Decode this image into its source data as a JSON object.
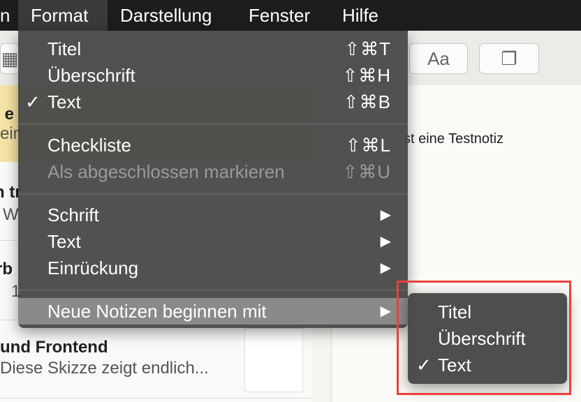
{
  "menubar": {
    "partial_item": "n",
    "items": [
      "Format",
      "Darstellung",
      "Fenster",
      "Hilfe"
    ]
  },
  "toolbar": {
    "font_button": "Aa"
  },
  "notes_list": {
    "note1": {
      "title_partial": "t e",
      "preview_partial": "ein"
    },
    "note2": {
      "title_partial": "n tr",
      "preview_partial": "W"
    },
    "note3": {
      "title_partial": "rb",
      "preview_partial": "1"
    },
    "note4": {
      "title": "und Frontend",
      "preview": "Diese Skizze zeigt endlich..."
    }
  },
  "editor": {
    "text": "st eine Testnotiz"
  },
  "format_menu": {
    "group1": [
      {
        "label": "Titel",
        "shortcut": "⇧⌘T",
        "checked": false
      },
      {
        "label": "Überschrift",
        "shortcut": "⇧⌘H",
        "checked": false
      },
      {
        "label": "Text",
        "shortcut": "⇧⌘B",
        "checked": true
      }
    ],
    "group2": [
      {
        "label": "Checkliste",
        "shortcut": "⇧⌘L",
        "enabled": true
      },
      {
        "label": "Als abgeschlossen markieren",
        "shortcut": "⇧⌘U",
        "enabled": false
      }
    ],
    "group3": [
      {
        "label": "Schrift",
        "submenu": true
      },
      {
        "label": "Text",
        "submenu": true
      },
      {
        "label": "Einrückung",
        "submenu": true
      }
    ],
    "group4": [
      {
        "label": "Neue Notizen beginnen mit",
        "submenu": true,
        "highlighted": true
      }
    ],
    "check_glyph": "✓",
    "arrow_glyph": "▶"
  },
  "submenu": {
    "items": [
      {
        "label": "Titel",
        "checked": false
      },
      {
        "label": "Überschrift",
        "checked": false
      },
      {
        "label": "Text",
        "checked": true
      }
    ]
  },
  "highlight_color": "#e8413c"
}
